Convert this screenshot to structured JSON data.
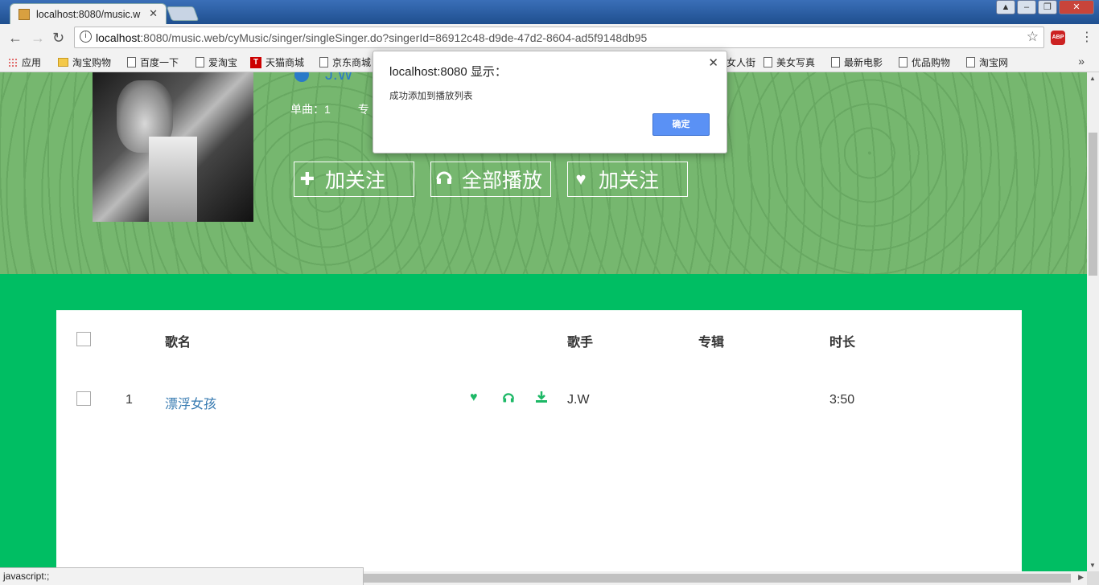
{
  "browser": {
    "tab_title": "localhost:8080/music.w",
    "url_host": "localhost",
    "url_rest": ":8080/music.web/cyMusic/singer/singleSinger.do?singerId=86912c48-d9de-47d2-8604-ad5f9148db95",
    "abp_label": "ABP",
    "bookmarks": [
      {
        "label": "应用",
        "icon": "apps-icon"
      },
      {
        "label": "淘宝购物",
        "icon": "folder-icon"
      },
      {
        "label": "百度一下",
        "icon": "page-icon"
      },
      {
        "label": "爱淘宝",
        "icon": "page-icon"
      },
      {
        "label": "天猫商城",
        "icon": "tmall-icon"
      },
      {
        "label": "京东商城",
        "icon": "page-icon"
      },
      {
        "label": "女人街",
        "icon": "page-icon"
      },
      {
        "label": "美女写真",
        "icon": "page-icon"
      },
      {
        "label": "最新电影",
        "icon": "page-icon"
      },
      {
        "label": "优品购物",
        "icon": "page-icon"
      },
      {
        "label": "淘宝网",
        "icon": "page-icon"
      }
    ],
    "status_text": "javascript:;"
  },
  "singer": {
    "name": "J.W",
    "stats": {
      "singles_label": "单曲：1",
      "album_label_partial": "专"
    },
    "buttons": {
      "follow1": "加关注",
      "play_all": "全部播放",
      "follow2": "加关注"
    }
  },
  "table": {
    "headers": {
      "song": "歌名",
      "singer": "歌手",
      "album": "专辑",
      "duration": "时长"
    },
    "rows": [
      {
        "index": "1",
        "song": "漂浮女孩",
        "singer": "J.W",
        "album": "",
        "duration": "3:50"
      }
    ]
  },
  "dialog": {
    "title": "localhost:8080 显示：",
    "message": "成功添加到播放列表",
    "ok_label": "确定"
  },
  "colors": {
    "accent_green": "#00be63",
    "hero_green": "#76b76f",
    "link_blue": "#3579b0",
    "dialog_button": "#5a91f5"
  }
}
